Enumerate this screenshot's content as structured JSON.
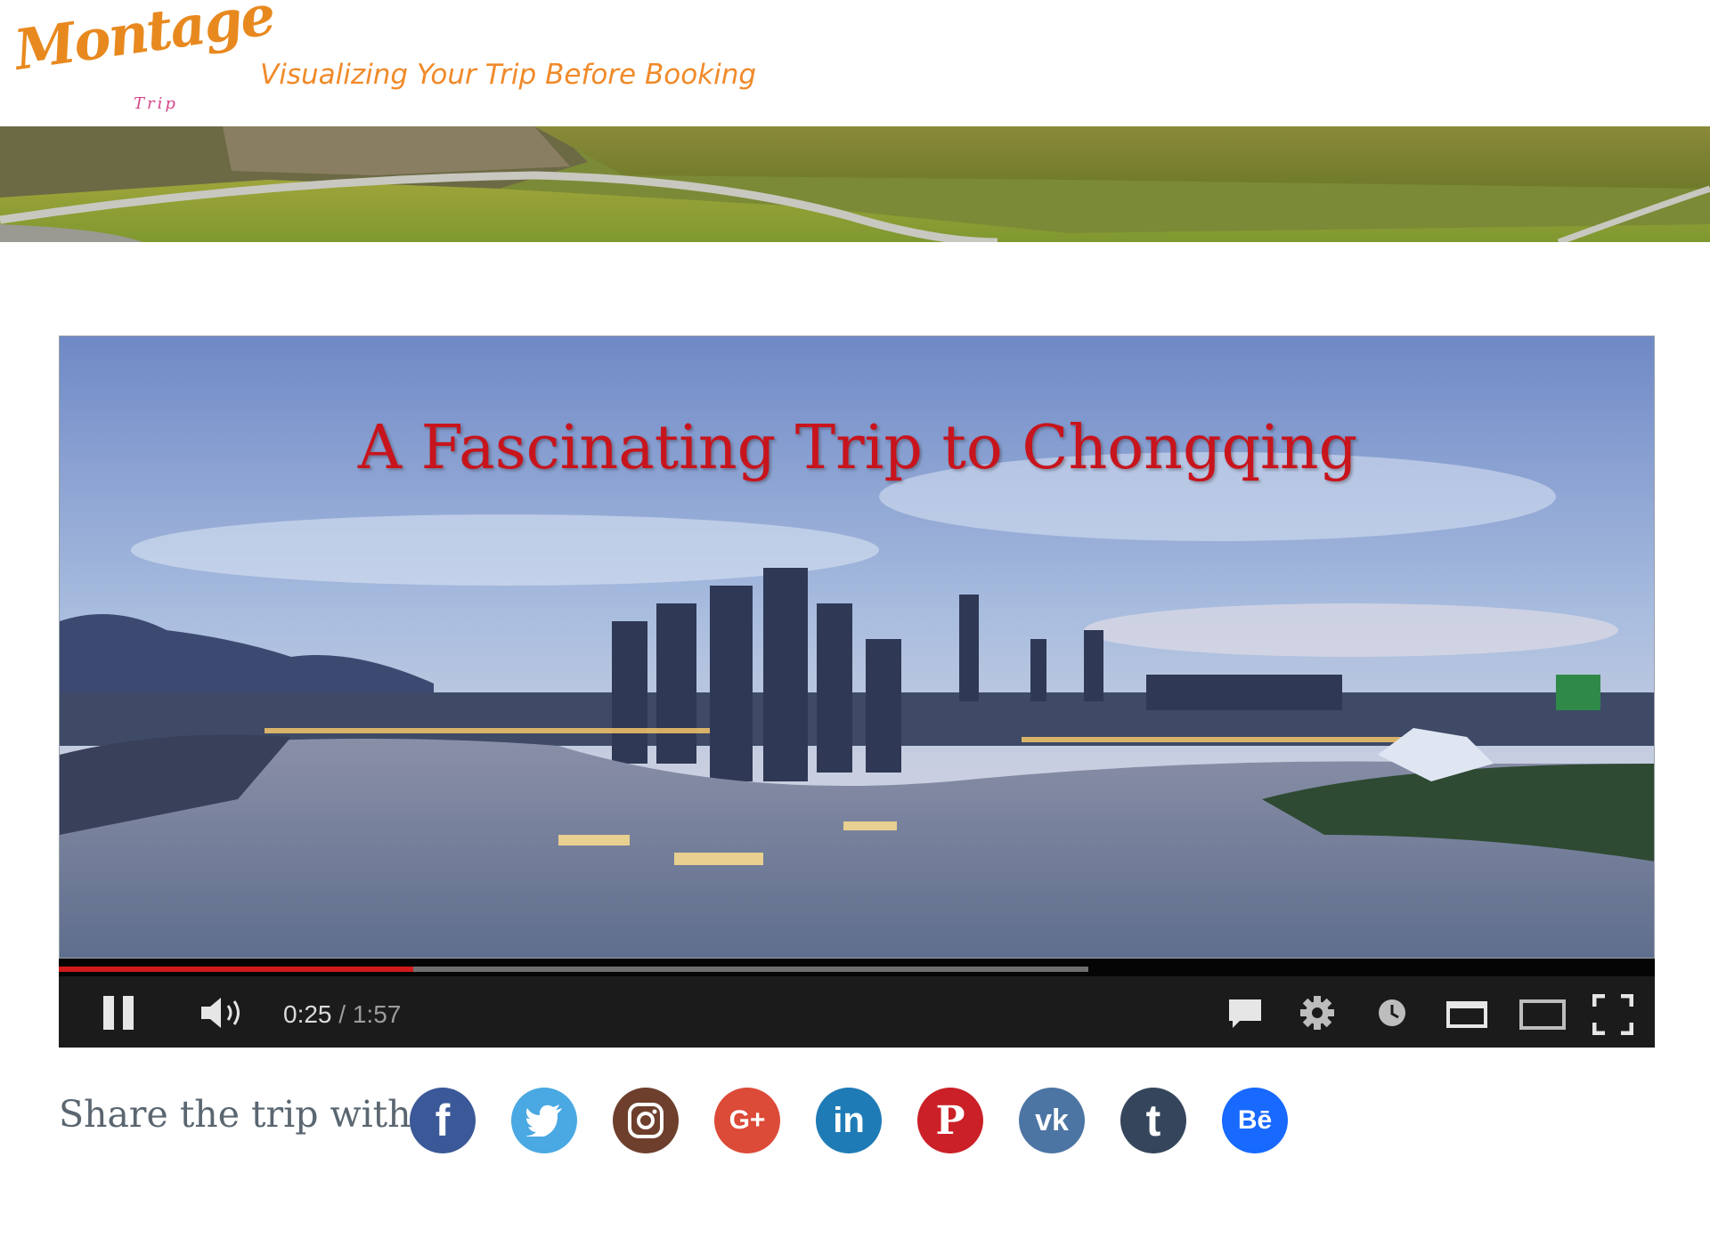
{
  "header": {
    "logo_text": "Montage",
    "logo_subtext": "Trip",
    "tagline": "Visualizing Your Trip Before Booking"
  },
  "video": {
    "title": "A Fascinating Trip to Chongqing",
    "current_time": "0:25",
    "separator": " / ",
    "duration": "1:57",
    "progress_played_fraction": 0.222,
    "progress_buffered_fraction": 0.645,
    "controls": [
      "pause-icon",
      "volume-icon",
      "subtitles-icon",
      "settings-icon",
      "watch-later-icon",
      "miniplayer-icon",
      "theater-mode-icon",
      "fullscreen-icon"
    ]
  },
  "share": {
    "label": "Share the trip with",
    "networks": [
      {
        "name": "facebook",
        "glyph": "f",
        "color": "#3b5998"
      },
      {
        "name": "twitter",
        "glyph": "",
        "color": "#4aa8e2"
      },
      {
        "name": "instagram",
        "glyph": "",
        "color": "#6d3f2c"
      },
      {
        "name": "google-plus",
        "glyph": "G+",
        "color": "#dc4a38"
      },
      {
        "name": "linkedin",
        "glyph": "in",
        "color": "#1f7bb6"
      },
      {
        "name": "pinterest",
        "glyph": "P",
        "color": "#cb2027"
      },
      {
        "name": "vk",
        "glyph": "vk",
        "color": "#4c75a3"
      },
      {
        "name": "tumblr",
        "glyph": "t",
        "color": "#35465c"
      },
      {
        "name": "behance",
        "glyph": "Bē",
        "color": "#1769ff"
      }
    ]
  }
}
